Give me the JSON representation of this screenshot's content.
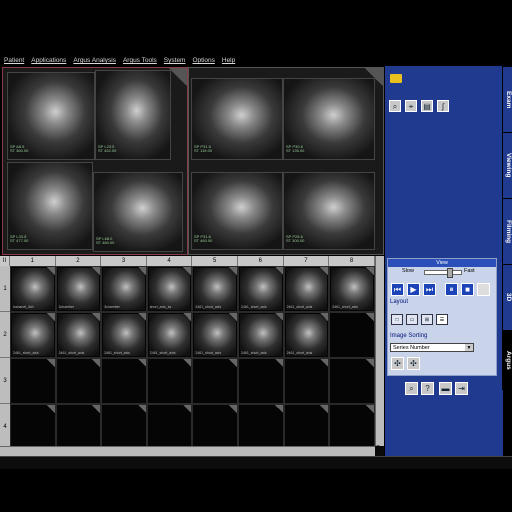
{
  "menu": [
    "Patient",
    "Applications",
    "Argus Analysis",
    "Argus Tools",
    "System",
    "Options",
    "Help"
  ],
  "viewer_left": [
    {
      "label": "SP A8.5\nST 360.00"
    },
    {
      "label": "SP L23.5\nST 452.00"
    },
    {
      "label": "SP L33.5\nST 477.00"
    },
    {
      "label": "SP L68.0\nST 480.00"
    }
  ],
  "viewer_right": [
    {
      "label": "SP P31.5\nST 115.00"
    },
    {
      "label": "SP P30.6\nST 135.00"
    },
    {
      "label": "SP P31.6\nST 460.00"
    },
    {
      "label": "SP P28.6\nST 300.00"
    }
  ],
  "grid": {
    "columns": [
      "1",
      "2",
      "3",
      "4",
      "5",
      "6",
      "7",
      "8"
    ],
    "rows": [
      "1",
      "2",
      "3",
      "4"
    ],
    "row1": [
      "lochanel_4ch",
      "2chamber",
      "3chamber",
      "short_axis_ss",
      "2461_short_axis",
      "2461_short_axis",
      "2461_short_axis",
      "2461_short_axis"
    ],
    "row2": [
      "2461_short_axis",
      "2461_short_axis",
      "2461_short_axis",
      "2461_short_axis",
      "2461_short_axis",
      "2461_short_axis",
      "2461_short_axis"
    ],
    "bottom_right_letters": [
      "E"
    ]
  },
  "view_panel": {
    "title": "View",
    "slow": "Slow",
    "fast": "Fast",
    "layout_label": "Layout",
    "sorting_label": "Image Sorting",
    "sorting_value": "Series Number",
    "speed_fraction": 0.68
  },
  "tabs": [
    "Exam",
    "Viewing",
    "Filming",
    "3D",
    "Argus"
  ],
  "colors": {
    "panel": "#1f3a8e",
    "panel_light": "#c9d3ea"
  }
}
